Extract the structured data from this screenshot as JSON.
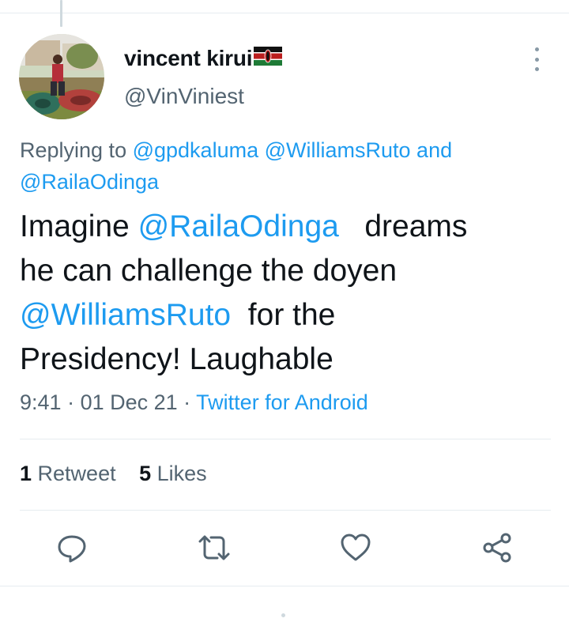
{
  "author": {
    "display_name": "vincent kirui",
    "handle": "@VinViniest"
  },
  "reply_context": {
    "prefix": "Replying to ",
    "mention1": "@gpdkaluma",
    "mention2": "@WilliamsRuto",
    "conjunction": " and",
    "mention3": "@RailaOdinga"
  },
  "tweet": {
    "part1": "Imagine ",
    "mention_raila": "@RailaOdinga",
    "part2": "   dreams\nhe can challenge the doyen\n",
    "mention_ruto": "@WilliamsRuto",
    "part3": "  for the\nPresidency! Laughable"
  },
  "meta": {
    "time": "9:41",
    "sep1": " · ",
    "date": "01 Dec 21",
    "sep2": " · ",
    "source": "Twitter for Android"
  },
  "stats": {
    "retweet_count": "1",
    "retweet_label": " Retweet",
    "like_count": "5",
    "like_label": " Likes"
  },
  "icons": {
    "reply": "comment-icon",
    "retweet": "retweet-icon",
    "like": "heart-icon",
    "share": "share-icon",
    "more": "more-vertical-icon",
    "flag": "kenya-flag-icon"
  },
  "colors": {
    "accent": "#1d9bf0",
    "secondary_text": "#536471",
    "primary_text": "#0f1419"
  }
}
